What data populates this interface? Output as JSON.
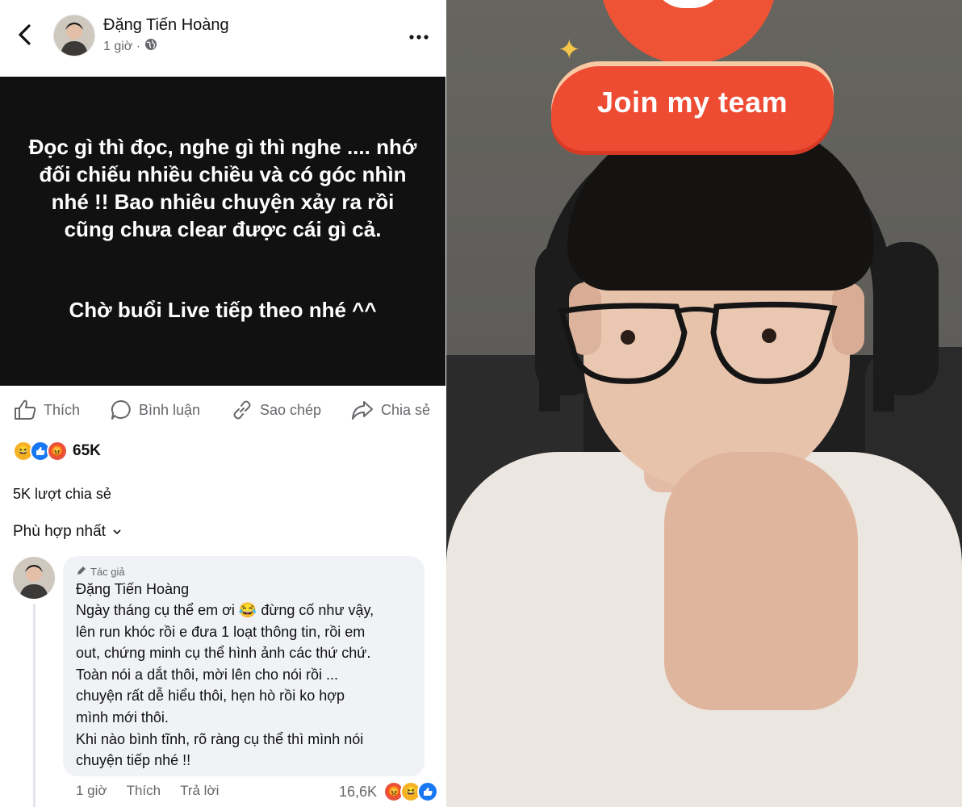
{
  "header": {
    "back_icon": "back-chevron-icon",
    "name": "Đặng Tiến Hoàng",
    "time": "1 giờ ·",
    "globe_icon": "globe-icon",
    "more_icon": "more-icon"
  },
  "post": {
    "background": "#111111",
    "text_main": "Đọc gì thì đọc, nghe gì thì nghe .... nhớ đối chiếu nhiều chiều và có góc nhìn nhé !! Bao nhiêu chuyện xảy ra rồi cũng chưa clear được cái gì cả.",
    "text_second": "Chờ buổi Live tiếp theo nhé ^^"
  },
  "actions": {
    "like": "Thích",
    "comment": "Bình luận",
    "copy": "Sao chép",
    "share": "Chia sẻ"
  },
  "stats": {
    "reaction_count": "65K",
    "shares": "5K lượt chia sẻ"
  },
  "sort": {
    "label": "Phù hợp nhất",
    "chevron": "⌄"
  },
  "comment": {
    "author_badge": "Tác giả",
    "name": "Đặng Tiến Hoàng",
    "body_line1": "Ngày tháng cụ thể em ơi 😂 đừng cố như vậy,",
    "body_line2": "lên run khóc rồi e đưa 1 loạt thông tin, rồi em",
    "body_line3": "out, chứng minh cụ thể hình ảnh các thứ chứ.",
    "body_line4": "Toàn nói a dắt thôi, mời lên cho nói rồi ...",
    "body_line5": "chuyện rất dễ hiểu thôi, hẹn hò rồi ko hợp",
    "body_line6": "mình mới thôi.",
    "body_line7": "Khi nào bình tĩnh, rõ ràng cụ thể thì mình nói",
    "body_line8": "chuyện tiếp nhé !!",
    "time": "1 giờ",
    "like": "Thích",
    "reply": "Trả lời",
    "reaction_count": "16,6K"
  },
  "stream": {
    "badge_text": "Join my team"
  },
  "colors": {
    "meta_gray": "#65676b",
    "bubble": "#f0f2f5",
    "like_blue": "#1877f2",
    "badge_red": "#ee4b33"
  }
}
